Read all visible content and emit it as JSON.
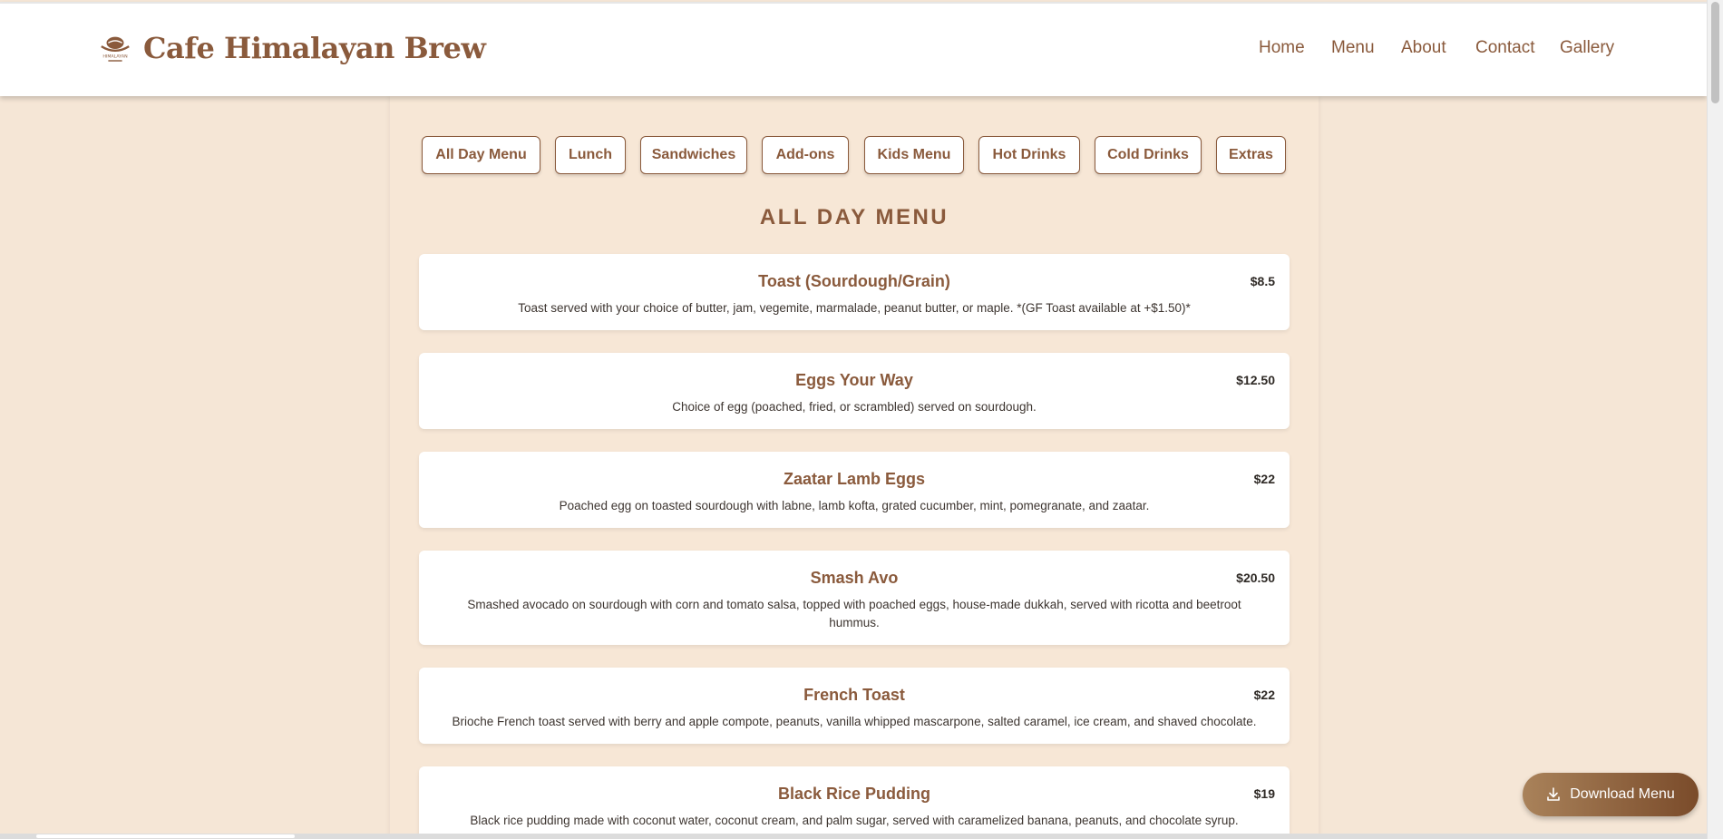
{
  "brand": {
    "name": "Cafe Himalayan Brew",
    "logo_text": "HIMALAYAN"
  },
  "nav": [
    "Home",
    "Menu",
    "About",
    "Contact",
    "Gallery"
  ],
  "tabs": [
    "All Day Menu",
    "Lunch",
    "Sandwiches",
    "Add-ons",
    "Kids Menu",
    "Hot Drinks",
    "Cold Drinks",
    "Extras"
  ],
  "section_title": "ALL DAY MENU",
  "items": [
    {
      "name": "Toast (Sourdough/Grain)",
      "price": "$8.5",
      "description": "Toast served with your choice of butter, jam, vegemite, marmalade, peanut butter, or maple. *(GF Toast available at +$1.50)*"
    },
    {
      "name": "Eggs Your Way",
      "price": "$12.50",
      "description": "Choice of egg (poached, fried, or scrambled) served on sourdough."
    },
    {
      "name": "Zaatar Lamb Eggs",
      "price": "$22",
      "description": "Poached egg on toasted sourdough with labne, lamb kofta, grated cucumber, mint, pomegranate, and zaatar."
    },
    {
      "name": "Smash Avo",
      "price": "$20.50",
      "description": "Smashed avocado on sourdough with corn and tomato salsa, topped with poached eggs, house-made dukkah, served with ricotta and beetroot hummus."
    },
    {
      "name": "French Toast",
      "price": "$22",
      "description": "Brioche French toast served with berry and apple compote, peanuts, vanilla whipped mascarpone, salted caramel, ice cream, and shaved chocolate."
    },
    {
      "name": "Black Rice Pudding",
      "price": "$19",
      "description": "Black rice pudding made with coconut water, coconut cream, and palm sugar, served with caramelized banana, peanuts, and chocolate syrup."
    }
  ],
  "download_label": "Download Menu",
  "colors": {
    "accent": "#8a5a3c",
    "background": "#f5e6d6",
    "card": "#ffffff"
  }
}
